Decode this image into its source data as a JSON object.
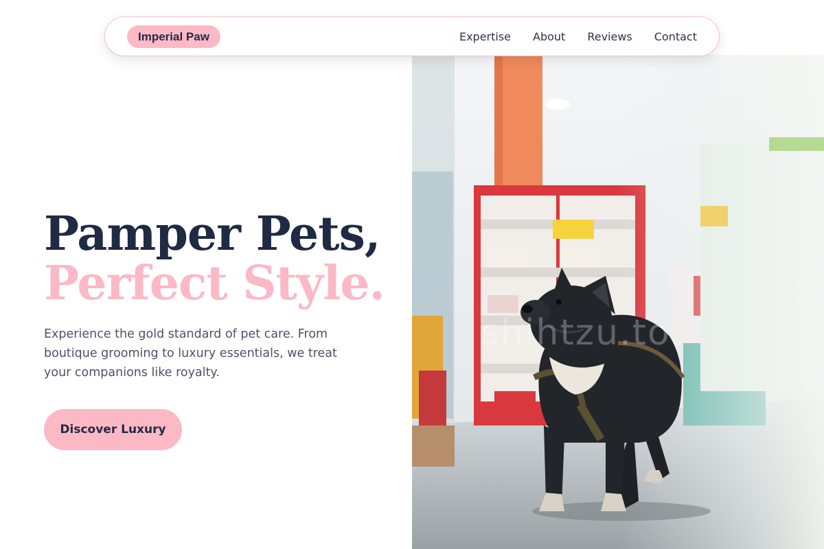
{
  "brand": {
    "name": "Imperial Paw"
  },
  "nav": {
    "items": [
      {
        "label": "Expertise"
      },
      {
        "label": "About"
      },
      {
        "label": "Reviews"
      },
      {
        "label": "Contact"
      }
    ]
  },
  "hero": {
    "headline_line1": "Pamper Pets,",
    "headline_line2": "Perfect Style.",
    "description": "Experience the gold standard of pet care. From boutique grooming to luxury essentials, we treat your companions like royalty.",
    "cta_label": "Discover Luxury",
    "image": {
      "subject": "french-bulldog-in-pet-store-photo",
      "watermark": "shihtzu.to"
    }
  },
  "colors": {
    "accent_pink": "#fbb9c6",
    "navy_text": "#1f2a44",
    "body_text": "#4a5366",
    "nav_border": "#f5bfca"
  }
}
